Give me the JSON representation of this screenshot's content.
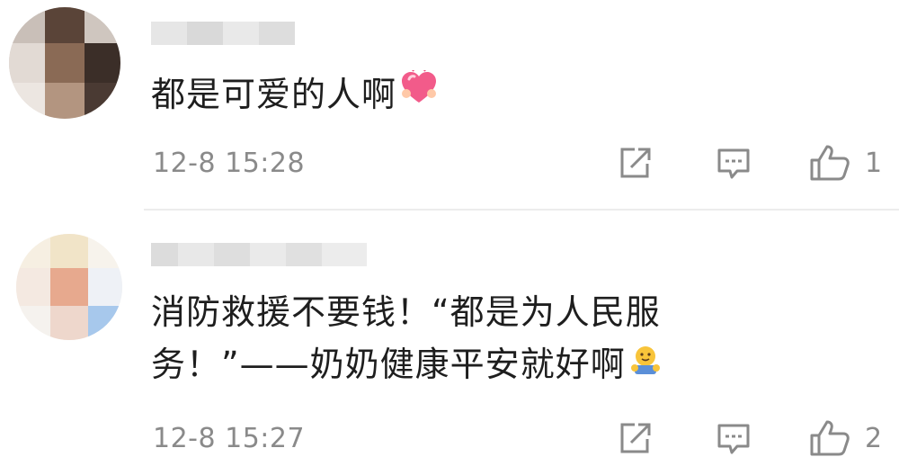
{
  "comments": [
    {
      "text": "都是可爱的人啊",
      "emoji_name": "heart-emoji",
      "timestamp": "12-8 15:28",
      "like_count": "1"
    },
    {
      "text_line1": "消防救援不要钱！“都是为人民服",
      "text_line2": "务！”——奶奶健康平安就好啊",
      "emoji_name": "hug-emoji",
      "timestamp": "12-8 15:27",
      "like_count": "2"
    }
  ],
  "icons": {
    "share": "share-icon",
    "reply": "reply-icon",
    "like": "thumbs-up-icon"
  },
  "colors": {
    "text": "#1e1e1e",
    "meta": "#8a8a8a",
    "icon": "#8a8a8a",
    "divider": "#ececec"
  }
}
